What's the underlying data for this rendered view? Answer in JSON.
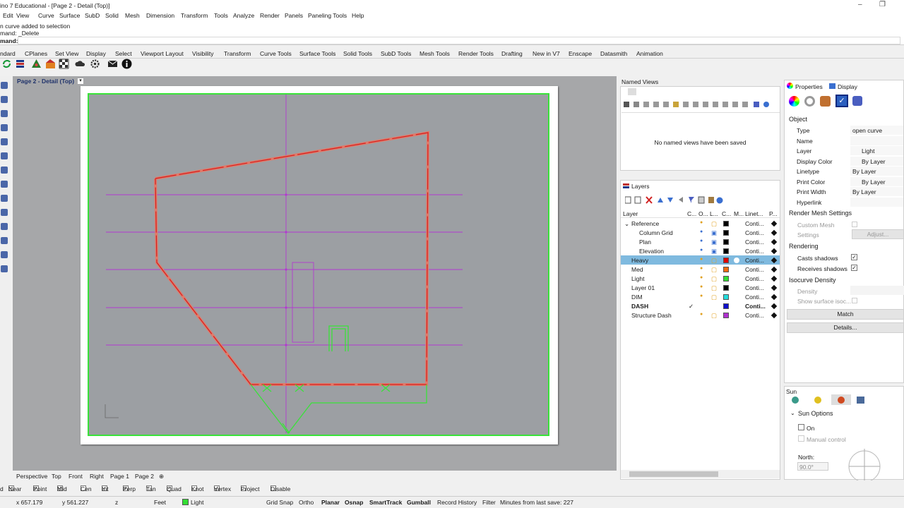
{
  "window": {
    "title": "ino 7 Educational - [Page 2 - Detail (Top)]"
  },
  "menu": [
    "Edit",
    "View",
    "Curve",
    "Surface",
    "SubD",
    "Solid",
    "Mesh",
    "Dimension",
    "Transform",
    "Tools",
    "Analyze",
    "Render",
    "Panels",
    "Paneling Tools",
    "Help"
  ],
  "command": {
    "history1": "n curve added to selection",
    "history2": "mand: _Delete",
    "prompt": "mand:"
  },
  "toolbar_tabs": [
    "ndard",
    "CPlanes",
    "Set View",
    "Display",
    "Select",
    "Viewport Layout",
    "Visibility",
    "Transform",
    "Curve Tools",
    "Surface Tools",
    "Solid Tools",
    "SubD Tools",
    "Mesh Tools",
    "Render Tools",
    "Drafting",
    "New in V7",
    "Enscape",
    "Datasmith",
    "Animation"
  ],
  "toolbar_icons": [
    "refresh-icon",
    "layers-stack-icon",
    "render-tree-icon",
    "render-scene-icon",
    "checker-icon",
    "cloud-icon",
    "settings-icon",
    "email-icon",
    "info-icon"
  ],
  "viewport": {
    "title": "Page 2 - Detail (Top)",
    "tabs": [
      "Perspective",
      "Top",
      "Front",
      "Right",
      "Page 1",
      "Page 2"
    ],
    "add_tab": "⊕"
  },
  "named_views": {
    "title": "Named Views",
    "empty_message": "No named views have been saved"
  },
  "layers": {
    "title": "Layers",
    "columns": [
      "Layer",
      "C...",
      "O...",
      "L...",
      "C...",
      "M...",
      "Linet...",
      "P..."
    ],
    "rows": [
      {
        "name": "Reference",
        "indent": 0,
        "expanded": true,
        "color": "#000000",
        "linetype": "Conti...",
        "locked": false,
        "bold": false,
        "selected": false,
        "current": false
      },
      {
        "name": "Column Grid",
        "indent": 1,
        "color": "#000000",
        "linetype": "Conti...",
        "locked": true,
        "bold": false,
        "selected": false,
        "current": false
      },
      {
        "name": "Plan",
        "indent": 1,
        "color": "#000000",
        "linetype": "Conti...",
        "locked": true,
        "bold": false,
        "selected": false,
        "current": false
      },
      {
        "name": "Elevation",
        "indent": 1,
        "color": "#000000",
        "linetype": "Conti...",
        "locked": true,
        "bold": false,
        "selected": false,
        "current": false
      },
      {
        "name": "Heavy",
        "indent": 0,
        "color": "#e00000",
        "linetype": "Conti...",
        "locked": false,
        "bold": false,
        "selected": true,
        "current": false
      },
      {
        "name": "Med",
        "indent": 0,
        "color": "#ee6a10",
        "linetype": "Conti...",
        "locked": false,
        "bold": false,
        "selected": false,
        "current": false
      },
      {
        "name": "Light",
        "indent": 0,
        "color": "#33dd33",
        "linetype": "Conti...",
        "locked": false,
        "bold": false,
        "selected": false,
        "current": false
      },
      {
        "name": "Layer 01",
        "indent": 0,
        "color": "#000000",
        "linetype": "Conti...",
        "locked": false,
        "bold": false,
        "selected": false,
        "current": false
      },
      {
        "name": "DIM",
        "indent": 0,
        "color": "#22dddd",
        "linetype": "Conti...",
        "locked": false,
        "bold": false,
        "selected": false,
        "current": false
      },
      {
        "name": "DASH",
        "indent": 0,
        "color": "#1010cc",
        "linetype": "Conti...",
        "locked": false,
        "bold": true,
        "selected": false,
        "current": true
      },
      {
        "name": "Structure Dash",
        "indent": 0,
        "color": "#b030d0",
        "linetype": "Conti...",
        "locked": false,
        "bold": false,
        "selected": false,
        "current": false
      }
    ]
  },
  "properties": {
    "tabs": [
      "Properties",
      "Display"
    ],
    "section_object": "Object",
    "fields": [
      {
        "label": "Type",
        "value": "open curve"
      },
      {
        "label": "Name",
        "value": ""
      },
      {
        "label": "Layer",
        "value": "Light"
      },
      {
        "label": "Display Color",
        "value": "By Layer"
      },
      {
        "label": "Linetype",
        "value": "By Layer"
      },
      {
        "label": "Print Color",
        "value": "By Layer"
      },
      {
        "label": "Print Width",
        "value": "By Layer"
      },
      {
        "label": "Hyperlink",
        "value": ""
      }
    ],
    "render_mesh": {
      "title": "Render Mesh Settings",
      "custom_mesh": "Custom Mesh",
      "settings": "Settings",
      "adjust": "Adjust..."
    },
    "rendering": {
      "title": "Rendering",
      "casts": "Casts shadows",
      "receives": "Receives shadows"
    },
    "isocurve": {
      "title": "Isocurve Density",
      "density": "Density",
      "show": "Show surface isoc..."
    },
    "match": "Match",
    "details": "Details..."
  },
  "sun": {
    "title": "Sun",
    "options": "Sun Options",
    "on": "On",
    "manual": "Manual control",
    "north_label": "North:",
    "north_value": "90.0°"
  },
  "osnap": [
    {
      "label": "d",
      "checked": null
    },
    {
      "label": "Near",
      "checked": true
    },
    {
      "label": "Point",
      "checked": true
    },
    {
      "label": "Mid",
      "checked": true
    },
    {
      "label": "Cen",
      "checked": false
    },
    {
      "label": "Int",
      "checked": true
    },
    {
      "label": "Perp",
      "checked": true
    },
    {
      "label": "Tan",
      "checked": false
    },
    {
      "label": "Quad",
      "checked": true
    },
    {
      "label": "Knot",
      "checked": false
    },
    {
      "label": "Vertex",
      "checked": true
    },
    {
      "label": "Project",
      "checked": false
    },
    {
      "label": "Disable",
      "checked": false
    }
  ],
  "status": {
    "x": "x 657.179",
    "y": "y 561.227",
    "z": "z",
    "units": "Feet",
    "layer": "Light",
    "layer_color": "#33dd33",
    "toggles": [
      "Grid Snap",
      "Ortho",
      "Planar",
      "Osnap",
      "SmartTrack",
      "Gumball",
      "Record History",
      "Filter"
    ],
    "bold_toggles": [
      "Planar",
      "Osnap",
      "SmartTrack",
      "Gumball"
    ],
    "save_info": "Minutes from last save: 227"
  },
  "colors": {
    "accent": "#2b79d0",
    "selection": "#7fbadf",
    "viewport_bg": "#a6a7a9",
    "detail_border": "#39e239"
  }
}
